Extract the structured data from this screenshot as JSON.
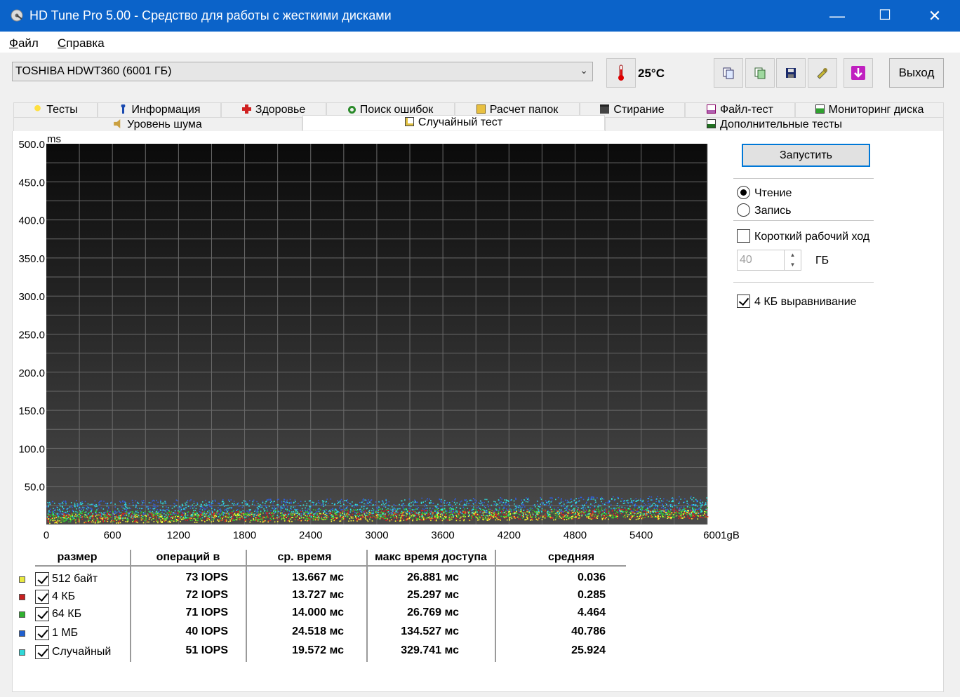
{
  "window": {
    "title": "HD Tune Pro 5.00 - Средство для работы с жесткими дисками",
    "minimize_glyph": "—",
    "maximize_glyph": "☐",
    "close_glyph": "✕"
  },
  "menu": [
    {
      "label_ul": "Ф",
      "label_rest": "айл"
    },
    {
      "label_ul": "С",
      "label_rest": "правка"
    }
  ],
  "toolbar": {
    "drive": "TOSHIBA HDWT360 (6001 ГБ)",
    "temperature": "25°C",
    "exit_label": "Выход",
    "icons": [
      "thermometer-icon",
      "copy-info-icon",
      "copy-screenshot-icon",
      "save-icon",
      "options-icon",
      "download-icon"
    ]
  },
  "tabs_row1": [
    "Тесты",
    "Информация",
    "Здоровье",
    "Поиск ошибок",
    "Расчет папок",
    "Стирание",
    "Файл-тест",
    "Мониторинг диска"
  ],
  "tabs_row2": [
    "Уровень шума",
    "Случайный тест",
    "Дополнительные тесты"
  ],
  "chart_data": {
    "type": "scatter",
    "ylabel": "ms",
    "xlabel_suffix": "gB",
    "y_ticks": [
      "500.0",
      "450.0",
      "400.0",
      "350.0",
      "300.0",
      "250.0",
      "200.0",
      "150.0",
      "100.0",
      "50.0"
    ],
    "x_ticks": [
      "0",
      "600",
      "1200",
      "1800",
      "2400",
      "3000",
      "3600",
      "4200",
      "4800",
      "5400",
      "6001gB"
    ],
    "xlim": [
      0,
      6001
    ],
    "ylim": [
      0,
      500
    ],
    "background": "#1a1a1a",
    "series": [
      {
        "name": "512 байт",
        "color": "#ffff30",
        "band": [
          2,
          14
        ]
      },
      {
        "name": "4 КБ",
        "color": "#e02020",
        "band": [
          3,
          16
        ]
      },
      {
        "name": "64 КБ",
        "color": "#30d030",
        "band": [
          4,
          18
        ]
      },
      {
        "name": "1 МБ",
        "color": "#3060e0",
        "band": [
          12,
          32
        ]
      },
      {
        "name": "Случайный",
        "color": "#30e0e0",
        "band": [
          8,
          30
        ]
      }
    ]
  },
  "side": {
    "start_label": "Запустить",
    "read_label": "Чтение",
    "write_label": "Запись",
    "short_stroke_label": "Короткий рабочий ход",
    "gb_value": "40",
    "gb_unit": "ГБ",
    "align_label": "4 КБ выравнивание"
  },
  "results": {
    "headers": [
      "размер",
      "операций в",
      "ср. время",
      "макс время доступа",
      "средняя"
    ],
    "rows": [
      {
        "name": "512 байт",
        "color": "#e8e840",
        "iops": "73 IOPS",
        "avg": "13.667 мс",
        "max": "26.881 мс",
        "mean": "0.036"
      },
      {
        "name": "4 КБ",
        "color": "#c82020",
        "iops": "72 IOPS",
        "avg": "13.727 мс",
        "max": "25.297 мс",
        "mean": "0.285"
      },
      {
        "name": "64 КБ",
        "color": "#30b030",
        "iops": "71 IOPS",
        "avg": "14.000 мс",
        "max": "26.769 мс",
        "mean": "4.464"
      },
      {
        "name": "1 МБ",
        "color": "#2060d0",
        "iops": "40 IOPS",
        "avg": "24.518 мс",
        "max": "134.527 мс",
        "mean": "40.786"
      },
      {
        "name": "Случайный",
        "color": "#30d8d8",
        "iops": "51 IOPS",
        "avg": "19.572 мс",
        "max": "329.741 мс",
        "mean": "25.924"
      }
    ]
  }
}
